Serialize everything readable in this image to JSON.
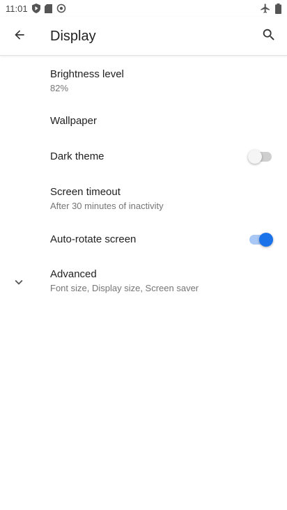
{
  "status_bar": {
    "time": "11:01",
    "left_icons": [
      "play-protect-icon",
      "sd-card-icon",
      "sync-icon"
    ],
    "right_icons": [
      "airplane-mode-icon",
      "battery-icon"
    ]
  },
  "app_bar": {
    "title": "Display",
    "back_icon": "arrow-back-icon",
    "search_icon": "search-icon"
  },
  "items": [
    {
      "title": "Brightness level",
      "summary": "82%"
    },
    {
      "title": "Wallpaper",
      "summary": ""
    },
    {
      "title": "Dark theme",
      "summary": "",
      "toggle": false
    },
    {
      "title": "Screen timeout",
      "summary": "After 30 minutes of inactivity"
    },
    {
      "title": "Auto-rotate screen",
      "summary": "",
      "toggle": true
    },
    {
      "title": "Advanced",
      "summary": "Font size, Display size, Screen saver",
      "icon": "chevron-down-icon"
    }
  ],
  "colors": {
    "accent": "#1a73e8",
    "accent_track": "#a9c8f5",
    "text_primary": "#212121",
    "text_secondary": "#757575"
  }
}
